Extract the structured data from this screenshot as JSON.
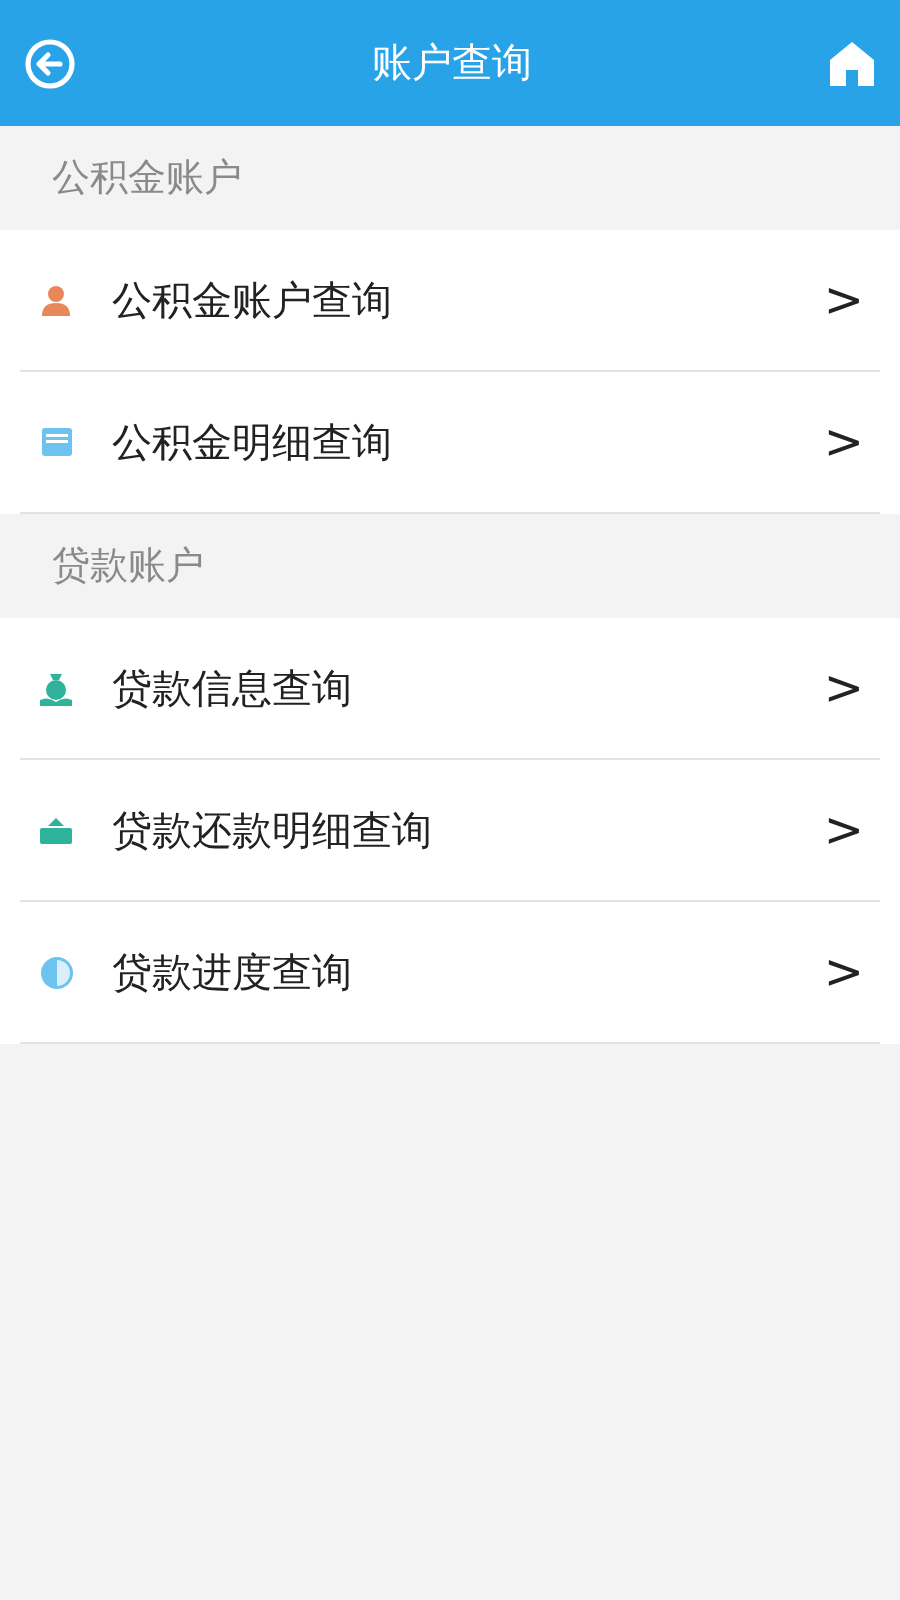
{
  "header": {
    "title": "账户查询"
  },
  "sections": [
    {
      "title": "公积金账户",
      "items": [
        {
          "kind": "person",
          "label": "公积金账户查询",
          "chevron": ">"
        },
        {
          "kind": "document",
          "label": "公积金明细查询",
          "chevron": ">"
        }
      ]
    },
    {
      "title": "贷款账户",
      "items": [
        {
          "kind": "moneybag",
          "label": "贷款信息查询",
          "chevron": ">"
        },
        {
          "kind": "repayment",
          "label": "贷款还款明细查询",
          "chevron": ">"
        },
        {
          "kind": "progress",
          "label": "贷款进度查询",
          "chevron": ">"
        }
      ]
    }
  ]
}
